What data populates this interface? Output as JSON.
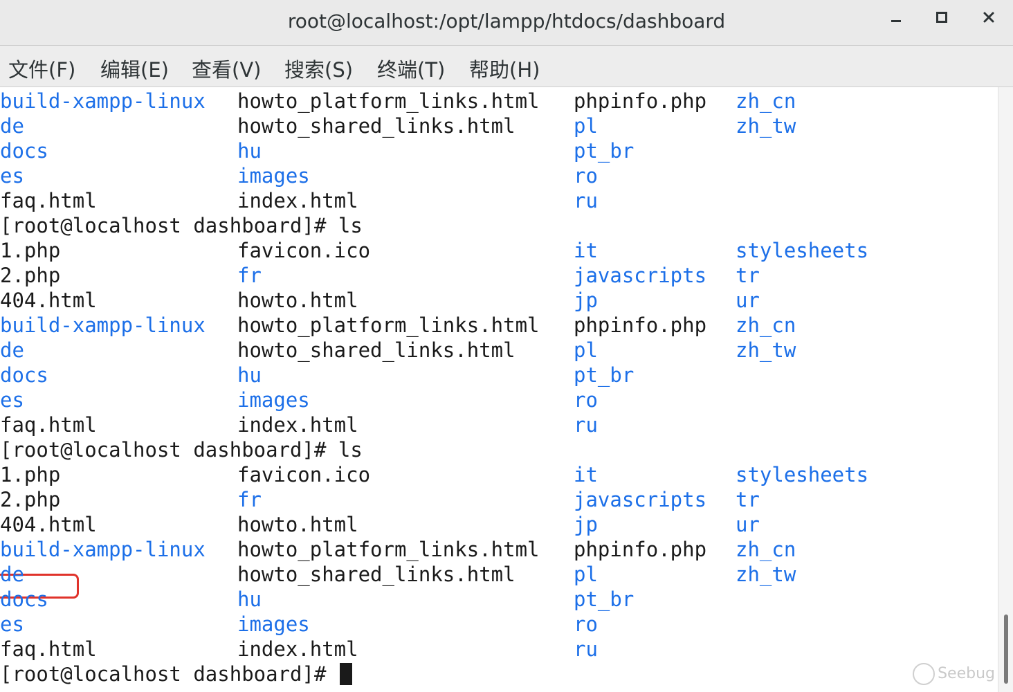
{
  "window": {
    "title": "root@localhost:/opt/lampp/htdocs/dashboard",
    "minimize_label": "–",
    "maximize_label": "□",
    "close_label": "×"
  },
  "menu": [
    "文件(F)",
    "编辑(E)",
    "查看(V)",
    "搜索(S)",
    "终端(T)",
    "帮助(H)"
  ],
  "terminal": {
    "lines": [
      [
        {
          "t": "build-xampp-linux",
          "k": "dir"
        },
        {
          "t": "howto_platform_links.html",
          "k": "file"
        },
        {
          "t": "phpinfo.php",
          "k": "file"
        },
        {
          "t": "zh_cn",
          "k": "dir"
        }
      ],
      [
        {
          "t": "de",
          "k": "dir"
        },
        {
          "t": "howto_shared_links.html",
          "k": "file"
        },
        {
          "t": "pl",
          "k": "dir"
        },
        {
          "t": "zh_tw",
          "k": "dir"
        }
      ],
      [
        {
          "t": "docs",
          "k": "dir"
        },
        {
          "t": "hu",
          "k": "dir"
        },
        {
          "t": "pt_br",
          "k": "dir"
        },
        {
          "t": "",
          "k": "file"
        }
      ],
      [
        {
          "t": "es",
          "k": "dir"
        },
        {
          "t": "images",
          "k": "dir"
        },
        {
          "t": "ro",
          "k": "dir"
        },
        {
          "t": "",
          "k": "file"
        }
      ],
      [
        {
          "t": "faq.html",
          "k": "file"
        },
        {
          "t": "index.html",
          "k": "file"
        },
        {
          "t": "ru",
          "k": "dir"
        },
        {
          "t": "",
          "k": "file"
        }
      ],
      [
        {
          "t": "[root@localhost dashboard]# ls",
          "k": "prompt"
        }
      ],
      [
        {
          "t": "1.php",
          "k": "file"
        },
        {
          "t": "favicon.ico",
          "k": "file"
        },
        {
          "t": "it",
          "k": "dir"
        },
        {
          "t": "stylesheets",
          "k": "dir"
        }
      ],
      [
        {
          "t": "2.php",
          "k": "file"
        },
        {
          "t": "fr",
          "k": "dir"
        },
        {
          "t": "javascripts",
          "k": "dir"
        },
        {
          "t": "tr",
          "k": "dir"
        }
      ],
      [
        {
          "t": "404.html",
          "k": "file"
        },
        {
          "t": "howto.html",
          "k": "file"
        },
        {
          "t": "jp",
          "k": "dir"
        },
        {
          "t": "ur",
          "k": "dir"
        }
      ],
      [
        {
          "t": "build-xampp-linux",
          "k": "dir"
        },
        {
          "t": "howto_platform_links.html",
          "k": "file"
        },
        {
          "t": "phpinfo.php",
          "k": "file"
        },
        {
          "t": "zh_cn",
          "k": "dir"
        }
      ],
      [
        {
          "t": "de",
          "k": "dir"
        },
        {
          "t": "howto_shared_links.html",
          "k": "file"
        },
        {
          "t": "pl",
          "k": "dir"
        },
        {
          "t": "zh_tw",
          "k": "dir"
        }
      ],
      [
        {
          "t": "docs",
          "k": "dir"
        },
        {
          "t": "hu",
          "k": "dir"
        },
        {
          "t": "pt_br",
          "k": "dir"
        },
        {
          "t": "",
          "k": "file"
        }
      ],
      [
        {
          "t": "es",
          "k": "dir"
        },
        {
          "t": "images",
          "k": "dir"
        },
        {
          "t": "ro",
          "k": "dir"
        },
        {
          "t": "",
          "k": "file"
        }
      ],
      [
        {
          "t": "faq.html",
          "k": "file"
        },
        {
          "t": "index.html",
          "k": "file"
        },
        {
          "t": "ru",
          "k": "dir"
        },
        {
          "t": "",
          "k": "file"
        }
      ],
      [
        {
          "t": "[root@localhost dashboard]# ls",
          "k": "prompt"
        }
      ],
      [
        {
          "t": "1.php",
          "k": "file"
        },
        {
          "t": "favicon.ico",
          "k": "file"
        },
        {
          "t": "it",
          "k": "dir"
        },
        {
          "t": "stylesheets",
          "k": "dir"
        }
      ],
      [
        {
          "t": "2.php",
          "k": "file"
        },
        {
          "t": "fr",
          "k": "dir"
        },
        {
          "t": "javascripts",
          "k": "dir"
        },
        {
          "t": "tr",
          "k": "dir"
        }
      ],
      [
        {
          "t": "404.html",
          "k": "file"
        },
        {
          "t": "howto.html",
          "k": "file"
        },
        {
          "t": "jp",
          "k": "dir"
        },
        {
          "t": "ur",
          "k": "dir"
        }
      ],
      [
        {
          "t": "build-xampp-linux",
          "k": "dir"
        },
        {
          "t": "howto_platform_links.html",
          "k": "file"
        },
        {
          "t": "phpinfo.php",
          "k": "file"
        },
        {
          "t": "zh_cn",
          "k": "dir"
        }
      ],
      [
        {
          "t": "de",
          "k": "dir"
        },
        {
          "t": "howto_shared_links.html",
          "k": "file"
        },
        {
          "t": "pl",
          "k": "dir"
        },
        {
          "t": "zh_tw",
          "k": "dir"
        }
      ],
      [
        {
          "t": "docs",
          "k": "dir"
        },
        {
          "t": "hu",
          "k": "dir"
        },
        {
          "t": "pt_br",
          "k": "dir"
        },
        {
          "t": "",
          "k": "file"
        }
      ],
      [
        {
          "t": "es",
          "k": "dir"
        },
        {
          "t": "images",
          "k": "dir"
        },
        {
          "t": "ro",
          "k": "dir"
        },
        {
          "t": "",
          "k": "file"
        }
      ],
      [
        {
          "t": "faq.html",
          "k": "file"
        },
        {
          "t": "index.html",
          "k": "file"
        },
        {
          "t": "ru",
          "k": "dir"
        },
        {
          "t": "",
          "k": "file"
        }
      ],
      [
        {
          "t": "[root@localhost dashboard]# ",
          "k": "prompt",
          "cursor": true
        }
      ]
    ]
  },
  "watermark": "Seebug",
  "colors": {
    "directory": "#1c6fe8",
    "text": "#1a1a1a",
    "highlight": "#e0332b"
  }
}
